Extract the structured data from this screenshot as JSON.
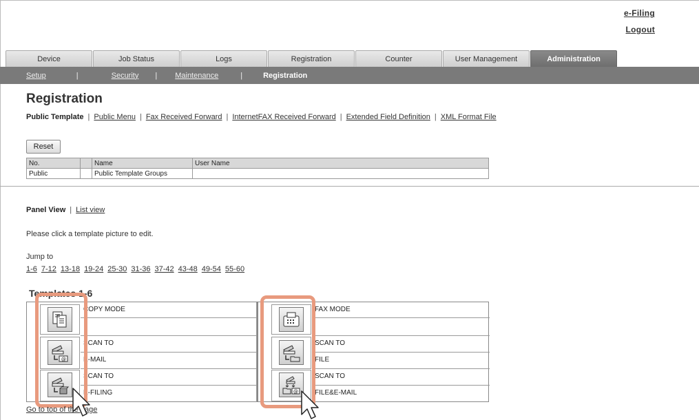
{
  "header": {
    "efiling": "e-Filing",
    "logout": "Logout"
  },
  "tabs": [
    "Device",
    "Job Status",
    "Logs",
    "Registration",
    "Counter",
    "User Management",
    "Administration"
  ],
  "subnav": {
    "setup": "Setup",
    "security": "Security",
    "maintenance": "Maintenance",
    "registration": "Registration",
    "sep": "|"
  },
  "page_title": "Registration",
  "reglinks": {
    "public_template": "Public Template",
    "public_menu": "Public Menu",
    "fax_forward": "Fax Received Forward",
    "ifax_forward": "InternetFAX Received Forward",
    "extended_field": "Extended Field Definition",
    "xml_format": "XML Format File",
    "sep": "|"
  },
  "reset_label": "Reset",
  "group_table": {
    "headers": [
      "No.",
      "",
      "Name",
      "User Name"
    ],
    "row": [
      "Public",
      "",
      "Public Template Groups",
      ""
    ]
  },
  "views": {
    "panel": "Panel View",
    "list": "List view",
    "sep": "|"
  },
  "instruction": "Please click a template picture to edit.",
  "jump_to": "Jump to",
  "ranges": [
    "1-6",
    "7-12",
    "13-18",
    "19-24",
    "25-30",
    "31-36",
    "37-42",
    "43-48",
    "49-54",
    "55-60"
  ],
  "templates_title": "Templates 1-6",
  "templates": {
    "t1": {
      "line1": "COPY MODE",
      "line2": ""
    },
    "t2": {
      "line1": "FAX MODE",
      "line2": ""
    },
    "t3": {
      "line1": "SCAN TO",
      "line2": "E-MAIL"
    },
    "t4": {
      "line1": "SCAN TO",
      "line2": "FILE"
    },
    "t5": {
      "line1": "SCAN TO",
      "line2": "E-FILING"
    },
    "t6": {
      "line1": "SCAN TO",
      "line2": "FILE&E-MAIL"
    }
  },
  "footer_link": "Go to top of the page",
  "colors": {
    "highlight": "#e89a7e",
    "subnav_bg": "#7a7a7a",
    "active_tab": "#7a7a7a"
  }
}
